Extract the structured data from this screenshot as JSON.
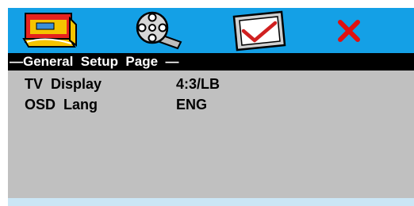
{
  "tabs": [
    {
      "icon": "general-setup-icon",
      "selected": true
    },
    {
      "icon": "audio-video-reel-icon",
      "selected": false
    },
    {
      "icon": "preference-checkmark-icon",
      "selected": false
    },
    {
      "icon": "exit-x-icon",
      "selected": false
    }
  ],
  "header": {
    "title": "—General  Setup  Page  —"
  },
  "settings": [
    {
      "label": "TV  Display",
      "value": "4:3/LB"
    },
    {
      "label": "OSD  Lang",
      "value": "ENG"
    }
  ],
  "colors": {
    "tab_bar": "#14a0e6",
    "header_bg": "#000000",
    "header_text": "#ffffff",
    "content_bg": "#c0c0c0",
    "footer_bg": "#cbe6f5",
    "exit_red": "#e01010",
    "check_red": "#d02020"
  }
}
